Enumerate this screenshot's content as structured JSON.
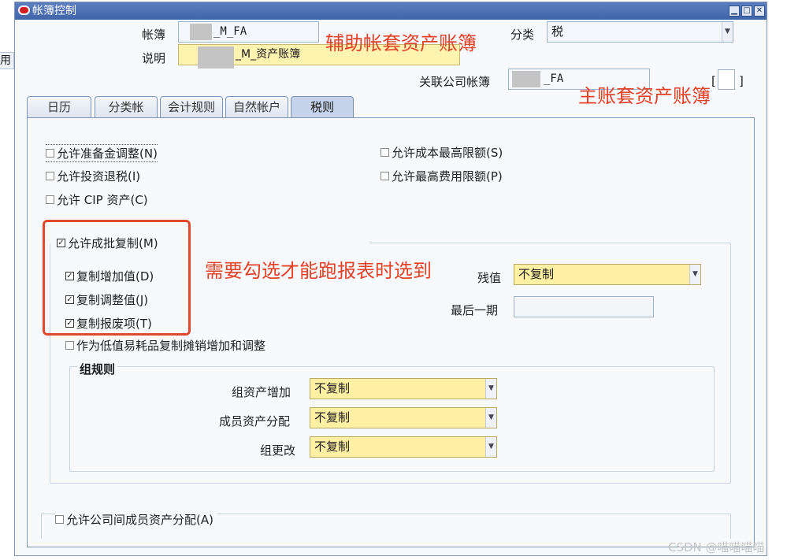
{
  "window": {
    "title": "帐簿控制"
  },
  "background_fragment": "用",
  "header": {
    "book_label": "帐簿",
    "book_value": "_M_FA",
    "desc_label": "说明",
    "desc_value": "_M_资产账簿",
    "category_label": "分类",
    "category_value": "税",
    "corp_book_label": "关联公司帐簿",
    "corp_book_value": "_FA",
    "bracket_open": "[",
    "bracket_close": "]"
  },
  "annotations": {
    "aux_book": "辅助帐套资产账簿",
    "main_book": "主账套资产账簿",
    "need_check": "需要勾选才能跑报表时选到"
  },
  "tabs": [
    {
      "label": "日历"
    },
    {
      "label": "分类帐"
    },
    {
      "label": "会计规则"
    },
    {
      "label": "自然帐户"
    },
    {
      "label": "税则"
    }
  ],
  "options": {
    "allow_reserve_adjust": {
      "label": "允许准备金调整(N)",
      "checked": false
    },
    "allow_invest_refund": {
      "label": "允许投资退税(I)",
      "checked": false
    },
    "allow_cip": {
      "label": "允许 CIP 资产(C)",
      "checked": false
    },
    "allow_cost_ceiling": {
      "label": "允许成本最高限额(S)",
      "checked": false
    },
    "allow_expense_ceiling": {
      "label": "允许最高费用限额(P)",
      "checked": false
    },
    "allow_mass_copy": {
      "label": "允许成批复制(M)",
      "checked": true
    },
    "copy_additions": {
      "label": "复制增加值(D)",
      "checked": true
    },
    "copy_adjustments": {
      "label": "复制调整值(J)",
      "checked": true
    },
    "copy_retirements": {
      "label": "复制报废项(T)",
      "checked": true
    },
    "copy_low_value": {
      "label": "作为低值易耗品复制摊销增加和调整",
      "checked": false
    },
    "allow_intercompany": {
      "label": "允许公司间成员资产分配(A)",
      "checked": false
    }
  },
  "salvage": {
    "label": "残值",
    "value": "不复制"
  },
  "last_period": {
    "label": "最后一期",
    "value": ""
  },
  "group_rules": {
    "title": "组规则",
    "rows": [
      {
        "label": "组资产增加",
        "value": "不复制"
      },
      {
        "label": "成员资产分配",
        "value": "不复制"
      },
      {
        "label": "组更改",
        "value": "不复制"
      }
    ]
  },
  "watermark": "CSDN @喵喵喵喵",
  "colors": {
    "accent": "#3f64a8",
    "annotation": "#e44126",
    "required": "#fff3b0"
  }
}
